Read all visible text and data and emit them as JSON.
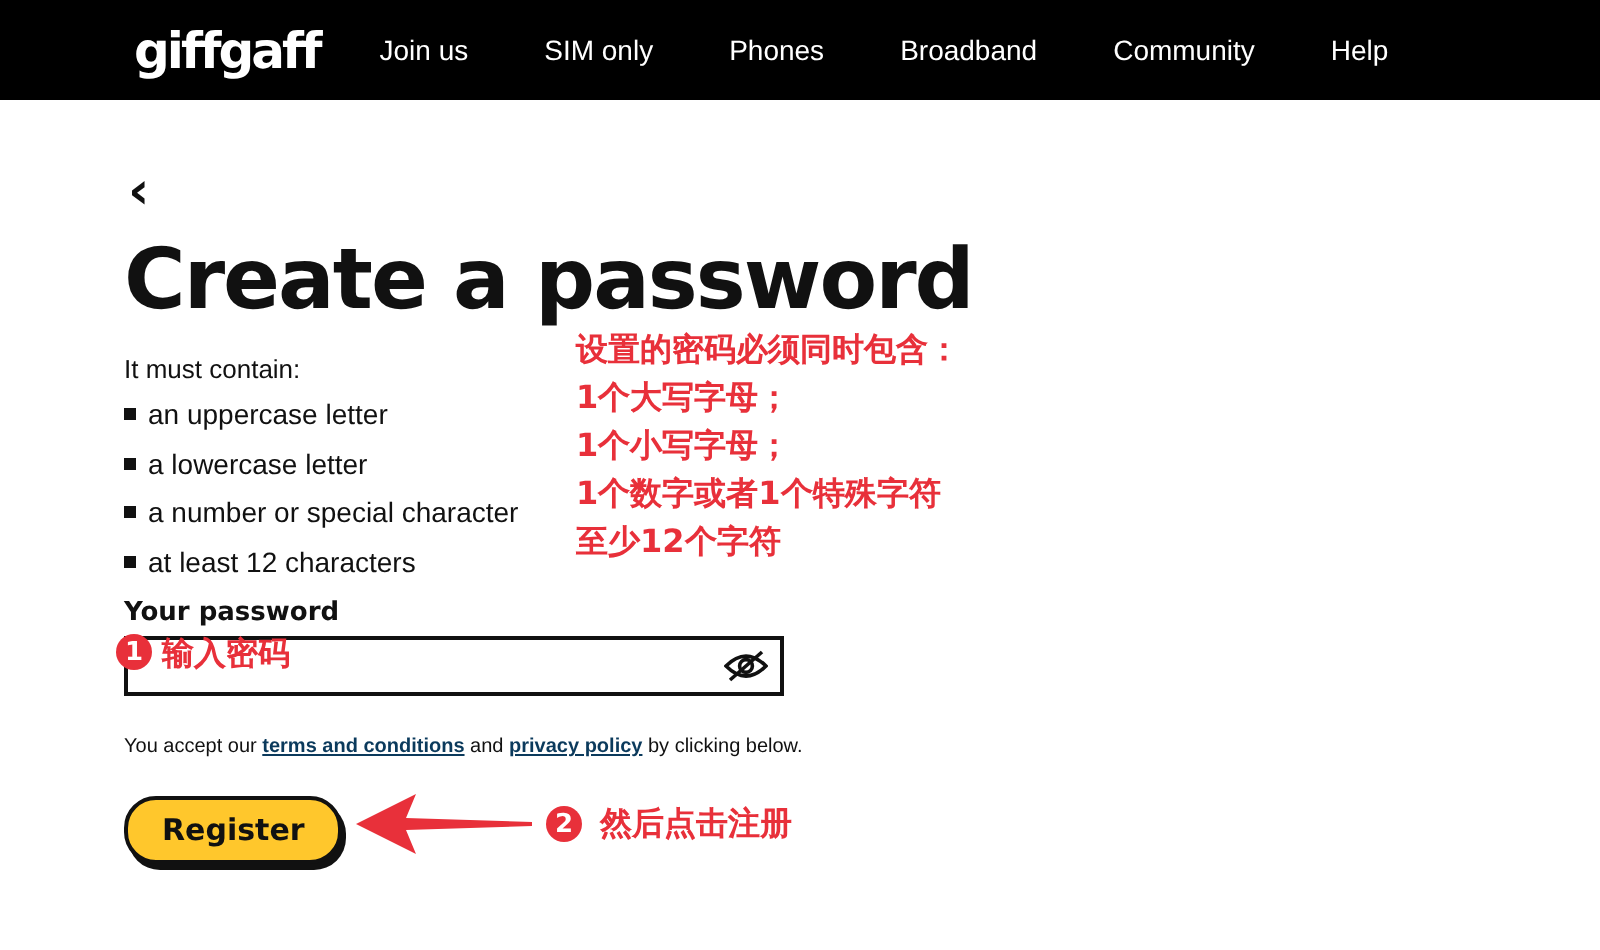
{
  "header": {
    "logo": "giffgaff",
    "nav": [
      "Join us",
      "SIM only",
      "Phones",
      "Broadband",
      "Community",
      "Help"
    ]
  },
  "page": {
    "back": "‹",
    "title": "Create a password",
    "intro": "It must contain:",
    "requirements": [
      "an uppercase letter",
      "a lowercase letter",
      "a number or special character",
      "at least 12 characters"
    ],
    "password_label": "Your password",
    "legal": {
      "before": "You accept our",
      "terms_link": "terms and conditions",
      "middle": "and",
      "privacy_link": "privacy policy",
      "after": "by clicking below."
    },
    "register_button": "Register"
  },
  "annotations": {
    "color": "#e8303a",
    "note_lines": [
      "设置的密码必须同时包含：",
      "1个大写字母；",
      "1个小写字母；",
      "1个数字或者1个特殊字符",
      "至少12个字符"
    ],
    "step_1": {
      "number": "1",
      "text": "输入密码"
    },
    "step_2": {
      "number": "2",
      "text": "然后点击注册"
    }
  }
}
